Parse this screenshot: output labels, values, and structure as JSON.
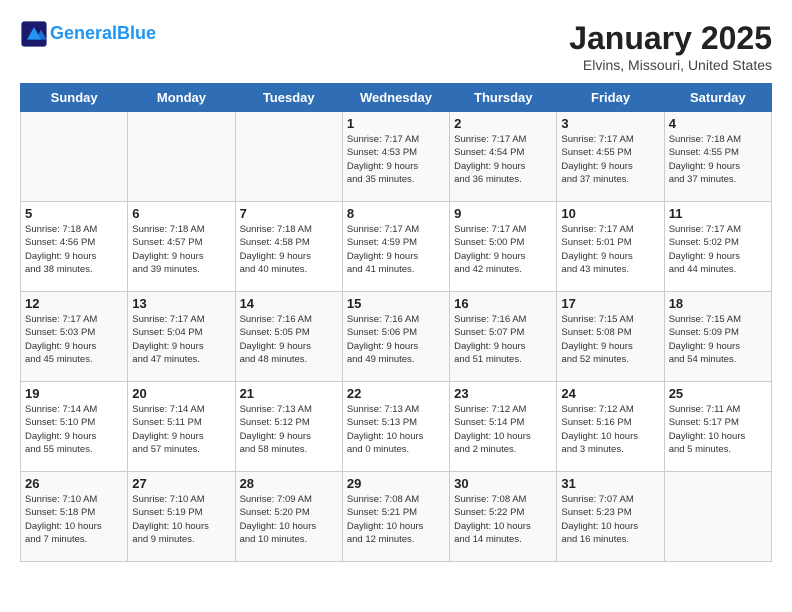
{
  "header": {
    "logo_line1": "General",
    "logo_line2": "Blue",
    "title": "January 2025",
    "subtitle": "Elvins, Missouri, United States"
  },
  "calendar": {
    "days_of_week": [
      "Sunday",
      "Monday",
      "Tuesday",
      "Wednesday",
      "Thursday",
      "Friday",
      "Saturday"
    ],
    "weeks": [
      [
        {
          "day": "",
          "info": ""
        },
        {
          "day": "",
          "info": ""
        },
        {
          "day": "",
          "info": ""
        },
        {
          "day": "1",
          "info": "Sunrise: 7:17 AM\nSunset: 4:53 PM\nDaylight: 9 hours\nand 35 minutes."
        },
        {
          "day": "2",
          "info": "Sunrise: 7:17 AM\nSunset: 4:54 PM\nDaylight: 9 hours\nand 36 minutes."
        },
        {
          "day": "3",
          "info": "Sunrise: 7:17 AM\nSunset: 4:55 PM\nDaylight: 9 hours\nand 37 minutes."
        },
        {
          "day": "4",
          "info": "Sunrise: 7:18 AM\nSunset: 4:55 PM\nDaylight: 9 hours\nand 37 minutes."
        }
      ],
      [
        {
          "day": "5",
          "info": "Sunrise: 7:18 AM\nSunset: 4:56 PM\nDaylight: 9 hours\nand 38 minutes."
        },
        {
          "day": "6",
          "info": "Sunrise: 7:18 AM\nSunset: 4:57 PM\nDaylight: 9 hours\nand 39 minutes."
        },
        {
          "day": "7",
          "info": "Sunrise: 7:18 AM\nSunset: 4:58 PM\nDaylight: 9 hours\nand 40 minutes."
        },
        {
          "day": "8",
          "info": "Sunrise: 7:17 AM\nSunset: 4:59 PM\nDaylight: 9 hours\nand 41 minutes."
        },
        {
          "day": "9",
          "info": "Sunrise: 7:17 AM\nSunset: 5:00 PM\nDaylight: 9 hours\nand 42 minutes."
        },
        {
          "day": "10",
          "info": "Sunrise: 7:17 AM\nSunset: 5:01 PM\nDaylight: 9 hours\nand 43 minutes."
        },
        {
          "day": "11",
          "info": "Sunrise: 7:17 AM\nSunset: 5:02 PM\nDaylight: 9 hours\nand 44 minutes."
        }
      ],
      [
        {
          "day": "12",
          "info": "Sunrise: 7:17 AM\nSunset: 5:03 PM\nDaylight: 9 hours\nand 45 minutes."
        },
        {
          "day": "13",
          "info": "Sunrise: 7:17 AM\nSunset: 5:04 PM\nDaylight: 9 hours\nand 47 minutes."
        },
        {
          "day": "14",
          "info": "Sunrise: 7:16 AM\nSunset: 5:05 PM\nDaylight: 9 hours\nand 48 minutes."
        },
        {
          "day": "15",
          "info": "Sunrise: 7:16 AM\nSunset: 5:06 PM\nDaylight: 9 hours\nand 49 minutes."
        },
        {
          "day": "16",
          "info": "Sunrise: 7:16 AM\nSunset: 5:07 PM\nDaylight: 9 hours\nand 51 minutes."
        },
        {
          "day": "17",
          "info": "Sunrise: 7:15 AM\nSunset: 5:08 PM\nDaylight: 9 hours\nand 52 minutes."
        },
        {
          "day": "18",
          "info": "Sunrise: 7:15 AM\nSunset: 5:09 PM\nDaylight: 9 hours\nand 54 minutes."
        }
      ],
      [
        {
          "day": "19",
          "info": "Sunrise: 7:14 AM\nSunset: 5:10 PM\nDaylight: 9 hours\nand 55 minutes."
        },
        {
          "day": "20",
          "info": "Sunrise: 7:14 AM\nSunset: 5:11 PM\nDaylight: 9 hours\nand 57 minutes."
        },
        {
          "day": "21",
          "info": "Sunrise: 7:13 AM\nSunset: 5:12 PM\nDaylight: 9 hours\nand 58 minutes."
        },
        {
          "day": "22",
          "info": "Sunrise: 7:13 AM\nSunset: 5:13 PM\nDaylight: 10 hours\nand 0 minutes."
        },
        {
          "day": "23",
          "info": "Sunrise: 7:12 AM\nSunset: 5:14 PM\nDaylight: 10 hours\nand 2 minutes."
        },
        {
          "day": "24",
          "info": "Sunrise: 7:12 AM\nSunset: 5:16 PM\nDaylight: 10 hours\nand 3 minutes."
        },
        {
          "day": "25",
          "info": "Sunrise: 7:11 AM\nSunset: 5:17 PM\nDaylight: 10 hours\nand 5 minutes."
        }
      ],
      [
        {
          "day": "26",
          "info": "Sunrise: 7:10 AM\nSunset: 5:18 PM\nDaylight: 10 hours\nand 7 minutes."
        },
        {
          "day": "27",
          "info": "Sunrise: 7:10 AM\nSunset: 5:19 PM\nDaylight: 10 hours\nand 9 minutes."
        },
        {
          "day": "28",
          "info": "Sunrise: 7:09 AM\nSunset: 5:20 PM\nDaylight: 10 hours\nand 10 minutes."
        },
        {
          "day": "29",
          "info": "Sunrise: 7:08 AM\nSunset: 5:21 PM\nDaylight: 10 hours\nand 12 minutes."
        },
        {
          "day": "30",
          "info": "Sunrise: 7:08 AM\nSunset: 5:22 PM\nDaylight: 10 hours\nand 14 minutes."
        },
        {
          "day": "31",
          "info": "Sunrise: 7:07 AM\nSunset: 5:23 PM\nDaylight: 10 hours\nand 16 minutes."
        },
        {
          "day": "",
          "info": ""
        }
      ]
    ]
  }
}
